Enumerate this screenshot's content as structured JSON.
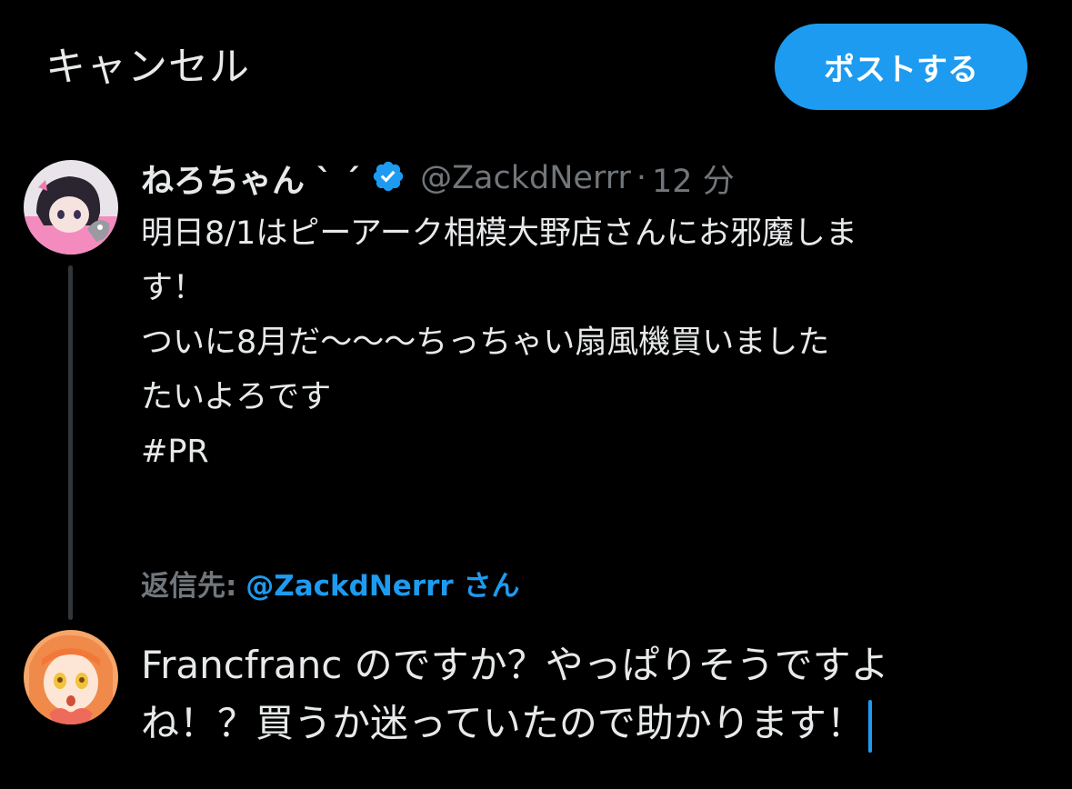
{
  "topbar": {
    "cancel_label": "キャンセル",
    "post_label": "ポストする"
  },
  "original_post": {
    "display_name": "ねろちゃん ` ´",
    "handle": "@ZackdNerrr",
    "separator": "·",
    "time": "12 分",
    "lines": [
      "明日8/1はピーアーク相模大野店さんにお邪魔しま",
      "す！",
      "ついに8月だ〜〜〜ちっちゃい扇風機買いました",
      "たいよろです",
      "#PR"
    ]
  },
  "reply_to": {
    "label": "返信先:",
    "handle": "@ZackdNerrr さん"
  },
  "compose": {
    "lines": [
      "Francfranc のですか？やっぱりそうですよ",
      "ね！？買うか迷っていたので助かります！"
    ]
  },
  "colors": {
    "background": "#000000",
    "accent": "#1d9bf0",
    "text": "#e7e9ea",
    "muted": "#71767b"
  }
}
